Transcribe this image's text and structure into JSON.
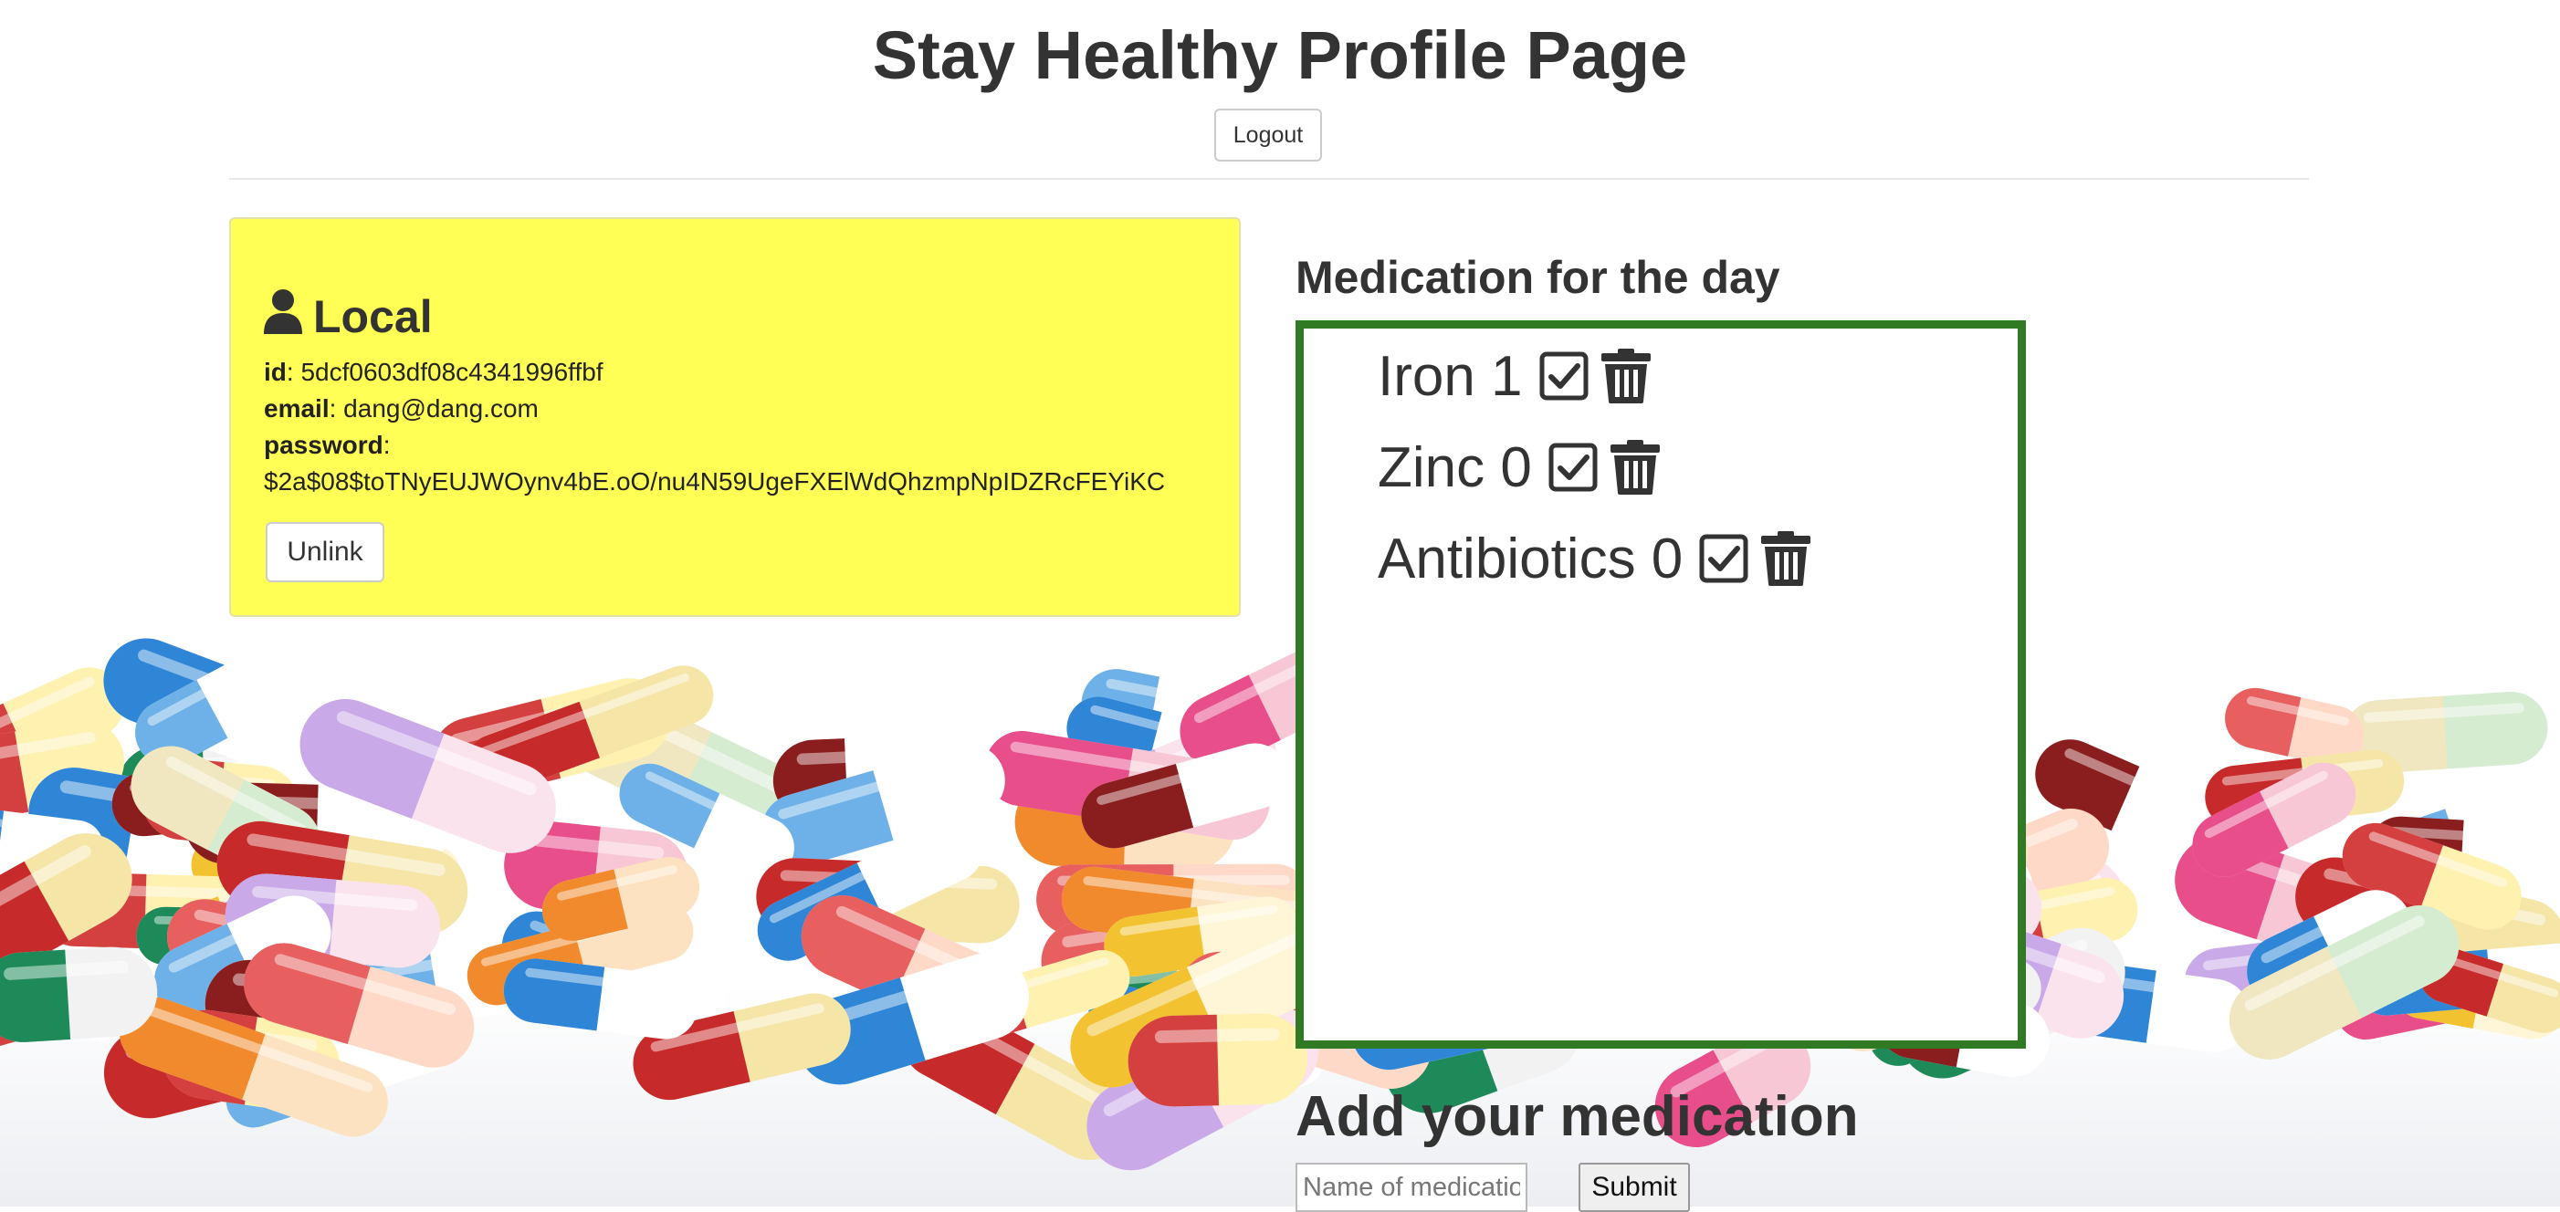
{
  "page": {
    "title": "Stay Healthy Profile Page"
  },
  "header": {
    "logout_label": "Logout"
  },
  "local": {
    "heading": "Local",
    "id_label": "id",
    "id_value": "5dcf0603df08c4341996ffbf",
    "email_label": "email",
    "email_value": "dang@dang.com",
    "password_label": "password",
    "password_value": "$2a$08$toTNyEUJWOynv4bE.oO/nu4N59UgeFXElWdQhzmpNpIDZRcFEYiKC",
    "unlink_label": "Unlink",
    "icon": "user-icon",
    "background_color": "#ffff55"
  },
  "medications": {
    "heading": "Medication for the day",
    "border_color": "#2f7a22",
    "items": [
      {
        "name": "Iron",
        "count": "1",
        "text": "Iron 1"
      },
      {
        "name": "Zinc",
        "count": "0",
        "text": "Zinc 0"
      },
      {
        "name": "Antibiotics",
        "count": "0",
        "text": "Antibiotics 0"
      }
    ],
    "check_icon": "check-square-icon",
    "delete_icon": "trash-icon"
  },
  "add_medication": {
    "heading": "Add your medication",
    "input_placeholder": "Name of medication",
    "input_value": "",
    "submit_label": "Submit"
  }
}
